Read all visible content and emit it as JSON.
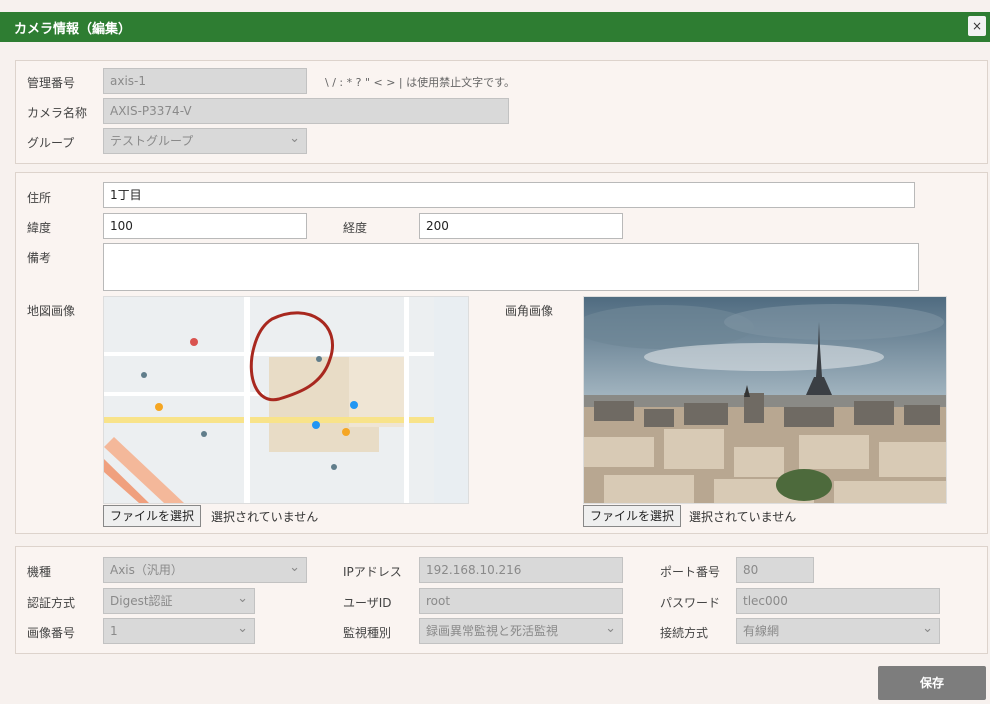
{
  "dialog": {
    "title": "カメラ情報（編集）",
    "close_label": "×"
  },
  "basic": {
    "management_no_label": "管理番号",
    "management_no_value": "axis-1",
    "management_no_hint": "\\ / : * ? \" < > | は使用禁止文字です。",
    "camera_name_label": "カメラ名称",
    "camera_name_value": "AXIS-P3374-V",
    "group_label": "グループ",
    "group_value": "テストグループ"
  },
  "location": {
    "address_label": "住所",
    "address_value": "1丁目",
    "latitude_label": "緯度",
    "latitude_value": "100",
    "longitude_label": "経度",
    "longitude_value": "200",
    "notes_label": "備考",
    "notes_value": "",
    "map_label": "地図画像",
    "view_label": "画角画像",
    "file_button_label": "ファイルを選択",
    "no_file_text": "選択されていません"
  },
  "settings": {
    "model_label": "機種",
    "model_value": "Axis（汎用）",
    "ip_label": "IPアドレス",
    "ip_value": "192.168.10.216",
    "port_label": "ポート番号",
    "port_value": "80",
    "auth_label": "認証方式",
    "auth_value": "Digest認証",
    "user_label": "ユーザID",
    "user_value": "root",
    "password_label": "パスワード",
    "password_value": "tlec000",
    "screen_no_label": "画像番号",
    "screen_no_value": "1",
    "monitor_label": "監視種別",
    "monitor_value": "録画異常監視と死活監視",
    "connection_label": "接続方式",
    "connection_value": "有線網"
  },
  "actions": {
    "save_label": "保存"
  },
  "colors": {
    "title_bar": "#2e7d32",
    "panel_bg": "#faf4f1",
    "save_button": "#7d7d7d"
  }
}
